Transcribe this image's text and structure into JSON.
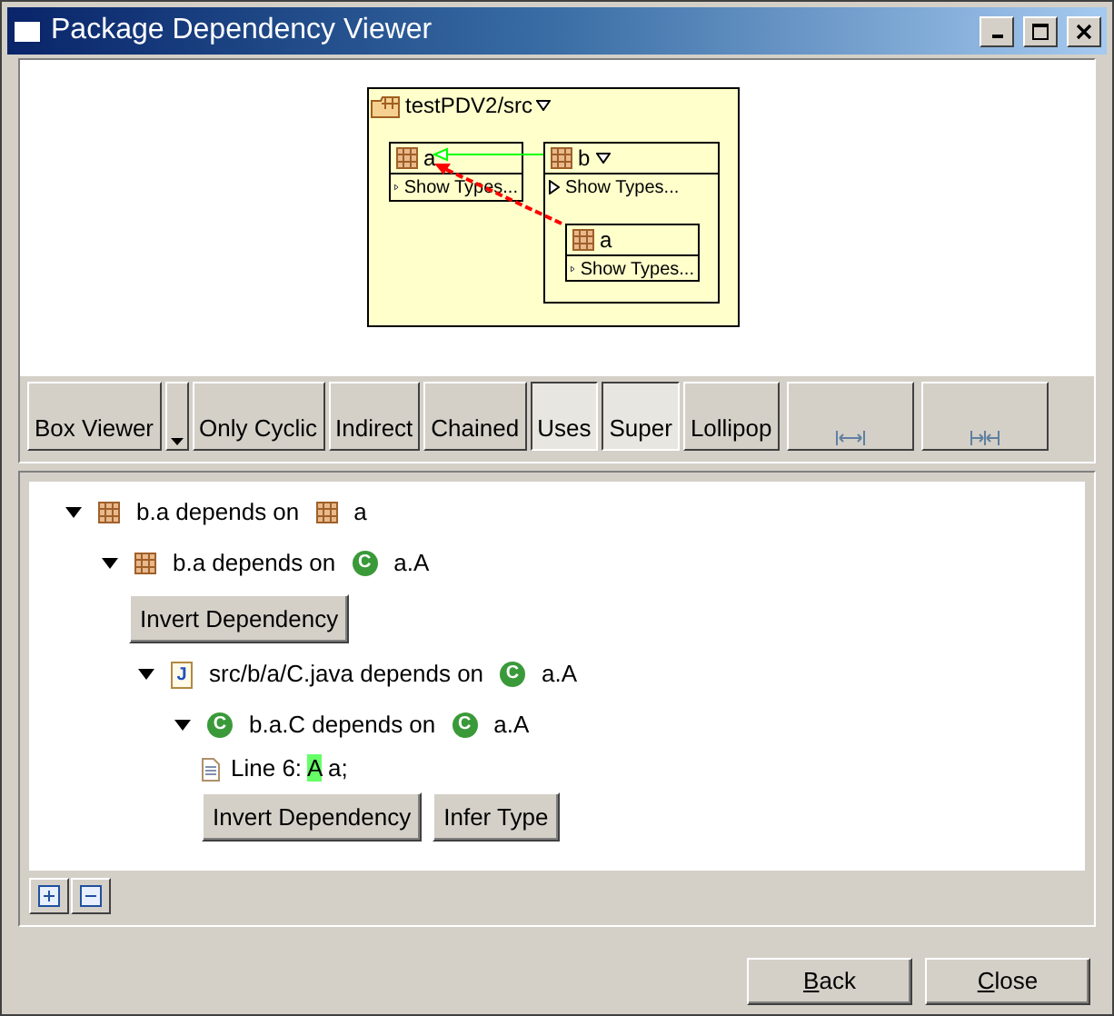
{
  "window": {
    "title": "Package Dependency Viewer"
  },
  "diagram": {
    "container": {
      "label": "testPDV2/src",
      "menu": true
    },
    "packages": [
      {
        "name": "a",
        "menu": false,
        "show_types": "Show Types..."
      },
      {
        "name": "b",
        "menu": true,
        "show_types": "Show Types...",
        "children": [
          {
            "name": "a",
            "menu": false,
            "show_types": "Show Types..."
          }
        ]
      }
    ],
    "edges": [
      {
        "kind": "inherit",
        "color": "#00ff00"
      },
      {
        "kind": "uses",
        "color": "#ff0000"
      }
    ]
  },
  "toolbar": [
    {
      "kind": "text",
      "label": "Box Viewer",
      "selected": false
    },
    {
      "kind": "dropdown",
      "selected": false
    },
    {
      "kind": "text",
      "label": "Only Cyclic",
      "selected": false
    },
    {
      "kind": "text",
      "label": "Indirect",
      "selected": false
    },
    {
      "kind": "text",
      "label": "Chained",
      "selected": false
    },
    {
      "kind": "text",
      "label": "Uses",
      "selected": true
    },
    {
      "kind": "text",
      "label": "Super",
      "selected": true
    },
    {
      "kind": "text",
      "label": "Lollipop",
      "selected": false
    },
    {
      "kind": "expand",
      "selected": false
    },
    {
      "kind": "collapse",
      "selected": false
    }
  ],
  "tree": [
    {
      "kind": "dependency",
      "expanded": true,
      "icon": {
        "kind": "package"
      },
      "text": "b.a depends on",
      "target_icon": {
        "kind": "package"
      },
      "target": "a",
      "children": [
        {
          "kind": "dependency",
          "expanded": true,
          "icon": {
            "kind": "package"
          },
          "text": "b.a depends on",
          "target_icon": {
            "kind": "class",
            "letter": "C"
          },
          "target": "a.A",
          "children": [
            {
              "kind": "buttons",
              "buttons": [
                "Invert Dependency"
              ]
            },
            {
              "kind": "dependency",
              "expanded": true,
              "icon": {
                "kind": "java",
                "letter": "J"
              },
              "text": "src/b/a/C.java depends on",
              "target_icon": {
                "kind": "class",
                "letter": "C"
              },
              "target": "a.A",
              "children": [
                {
                  "kind": "dependency",
                  "expanded": true,
                  "icon": {
                    "kind": "class",
                    "letter": "C"
                  },
                  "text": "b.a.C depends on",
                  "target_icon": {
                    "kind": "class",
                    "letter": "C"
                  },
                  "target": "a.A",
                  "children": [
                    {
                      "kind": "line",
                      "prefix": "Line 6:",
                      "highlight": "A",
                      "suffix": "a;"
                    },
                    {
                      "kind": "buttons",
                      "buttons": [
                        "Invert Dependency",
                        "Infer Type"
                      ]
                    }
                  ]
                }
              ]
            }
          ]
        }
      ]
    }
  ],
  "tree_footer": [
    {
      "kind": "expand-all"
    },
    {
      "kind": "collapse-all"
    }
  ],
  "buttons": [
    {
      "label": "Back",
      "mnemonic": true
    },
    {
      "label": "Close",
      "mnemonic": true
    }
  ]
}
